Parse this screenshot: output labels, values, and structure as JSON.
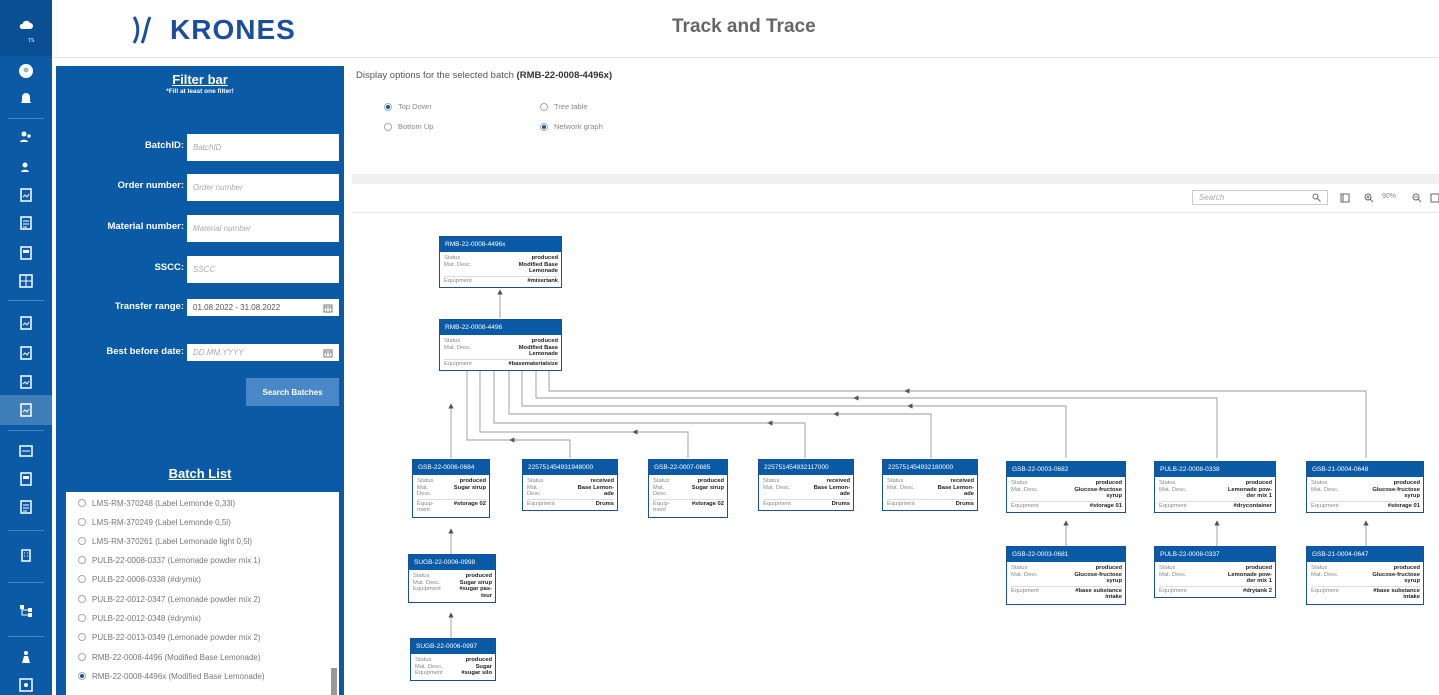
{
  "header": {
    "brand": "KRONES",
    "title": "Track and Trace",
    "rail_badge": "TS"
  },
  "colors": {
    "primary": "#0b5aa6",
    "node_header": "#0b5aa6",
    "accent_button": "#4a87c8"
  },
  "rail_icons": [
    "cloud-icon",
    "user-avatar-icon",
    "bell-icon",
    "users-icon",
    "user-icon",
    "report-icon",
    "list-icon",
    "document-icon",
    "grid-icon",
    "report-icon",
    "report-icon",
    "report-icon",
    "report-icon",
    "dashboard-icon",
    "document-icon",
    "list-icon",
    "building-icon",
    "hierarchy-icon",
    "person-icon",
    "image-icon"
  ],
  "filter": {
    "title": "Filter bar",
    "subtitle": "*Fill at least one filter!",
    "fields": {
      "batch_id": {
        "label": "BatchID:",
        "placeholder": "BatchID",
        "value": ""
      },
      "order_number": {
        "label": "Order number:",
        "placeholder": "Order number",
        "value": ""
      },
      "material_number": {
        "label": "Material number:",
        "placeholder": "Material number",
        "value": ""
      },
      "sscc": {
        "label": "SSCC:",
        "placeholder": "SSCC",
        "value": ""
      },
      "transfer_range": {
        "label": "Transfer range:",
        "value": "01.08.2022 - 31.08.2022"
      },
      "best_before": {
        "label": "Best before date:",
        "placeholder": "DD.MM.YYYY"
      }
    },
    "search_button": "Search Batches"
  },
  "batch_list": {
    "title": "Batch List",
    "items": [
      {
        "label": "LMS-RM-370248 (Label Lemonde 0,33l)",
        "selected": false
      },
      {
        "label": "LMS-RM-370249 (Label Lemonde 0,5l)",
        "selected": false
      },
      {
        "label": "LMS-RM-370261 (Label Lemonade light 0,5l)",
        "selected": false
      },
      {
        "label": "PULB-22-0008-0337 (Lemonade powder mix 1)",
        "selected": false
      },
      {
        "label": "PULB-22-0008-0338 (#drymix)",
        "selected": false
      },
      {
        "label": "PULB-22-0012-0347 (Lemonade powder mix 2)",
        "selected": false
      },
      {
        "label": "PULB-22-0012-0348 (#drymix)",
        "selected": false
      },
      {
        "label": "PULB-22-0013-0349 (Lemonade powder mix 2)",
        "selected": false
      },
      {
        "label": "RMB-22-0008-4496 (Modified Base Lemonade)",
        "selected": false
      },
      {
        "label": "RMB-22-0008-4496x (Modified Base Lemonade)",
        "selected": true
      }
    ]
  },
  "display_options": {
    "title": "Display options for the selected batch",
    "batch": "(RMB-22-0008-4496x)",
    "options": [
      {
        "label": "Top Down",
        "selected": true
      },
      {
        "label": "Bottom Up",
        "selected": false
      },
      {
        "label": "Tree table",
        "selected": false
      },
      {
        "label": "Network graph",
        "selected": true
      }
    ]
  },
  "graph_toolbar": {
    "search_placeholder": "Search",
    "zoom": "90%"
  },
  "row_labels": {
    "status": "Status",
    "mat_desc": "Mat. Desc.",
    "equipment": "Equipment",
    "mat": "Mat.",
    "desc": "Desc.",
    "equipment_split": [
      "Equip-",
      "ment"
    ]
  },
  "nodes": [
    {
      "id": "RMB-22-0008-4496x",
      "status": "produced",
      "desc": [
        "Modified Base",
        "Lemonade"
      ],
      "equipment": [
        "#mixertank"
      ]
    },
    {
      "id": "RMB-22-0008-4496",
      "status": "produced",
      "desc": [
        "Modified Base",
        "Lemonade"
      ],
      "equipment": [
        "#basematerialsize"
      ]
    },
    {
      "id": "GSB-22-0006-0684",
      "status": "produced",
      "desc": [
        "Sugar sirup"
      ],
      "equipment": [
        "#storage 02"
      ]
    },
    {
      "id": "225751454931948000",
      "status": "received",
      "desc": [
        "Base Lemon-",
        "ade"
      ],
      "equipment": [
        "Drums"
      ]
    },
    {
      "id": "GSB-22-0007-0685",
      "status": "produced",
      "desc": [
        "Sugar sirup"
      ],
      "equipment": [
        "#storage 02"
      ]
    },
    {
      "id": "225751454932117000",
      "status": "received",
      "desc": [
        "Base Lemon-",
        "ade"
      ],
      "equipment": [
        "Drums"
      ]
    },
    {
      "id": "225751454932180000",
      "status": "received",
      "desc": [
        "Base Lemon-",
        "ade"
      ],
      "equipment": [
        "Drums"
      ]
    },
    {
      "id": "GSB-22-0003-0682",
      "status": "produced",
      "desc": [
        "Glucose-fructose",
        "syrup"
      ],
      "equipment": [
        "#storage 01"
      ]
    },
    {
      "id": "PULB-22-0008-0338",
      "status": "produced",
      "desc": [
        "Lemonade pow-",
        "der mix 1"
      ],
      "equipment": [
        "#drycontainer"
      ]
    },
    {
      "id": "GSB-21-0004-0648",
      "status": "produced",
      "desc": [
        "Glucose-fructose",
        "syrup"
      ],
      "equipment": [
        "#storage 01"
      ]
    },
    {
      "id": "SUGB-22-0006-0998",
      "status": "produced",
      "desc": [
        "Sugar sirup"
      ],
      "equipment": [
        "#sugar pas-",
        "teur"
      ]
    },
    {
      "id": "GSB-22-0003-0681",
      "status": "produced",
      "desc": [
        "Glucose-fructose",
        "syrup"
      ],
      "equipment": [
        "#base substance",
        "intake"
      ]
    },
    {
      "id": "PULB-22-0008-0337",
      "status": "produced",
      "desc": [
        "Lemonade pow-",
        "der mix 1"
      ],
      "equipment": [
        "#drytank 2"
      ]
    },
    {
      "id": "GSB-21-0004-0647",
      "status": "produced",
      "desc": [
        "Glucose-fructose",
        "syrup"
      ],
      "equipment": [
        "#base substance",
        "intake"
      ]
    },
    {
      "id": "SUGB-22-0006-0997",
      "status": "produced",
      "desc": [
        "Sugar"
      ],
      "equipment": [
        "#sugar silo"
      ]
    }
  ]
}
